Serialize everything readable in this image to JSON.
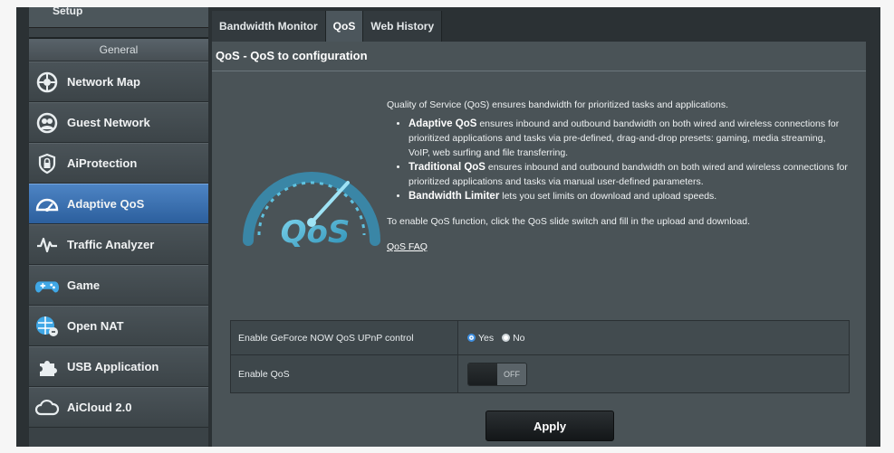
{
  "sidebar": {
    "top_item": "Setup",
    "group_header": "General",
    "items": [
      {
        "label": "Network Map",
        "icon": "network-map-icon"
      },
      {
        "label": "Guest Network",
        "icon": "guest-network-icon"
      },
      {
        "label": "AiProtection",
        "icon": "shield-lock-icon"
      },
      {
        "label": "Adaptive QoS",
        "icon": "speedometer-icon",
        "active": true
      },
      {
        "label": "Traffic Analyzer",
        "icon": "waveform-icon"
      },
      {
        "label": "Game",
        "icon": "gamepad-icon"
      },
      {
        "label": "Open NAT",
        "icon": "open-nat-icon"
      },
      {
        "label": "USB Application",
        "icon": "usb-puzzle-icon"
      },
      {
        "label": "AiCloud 2.0",
        "icon": "cloud-icon"
      }
    ]
  },
  "tabs": [
    {
      "label": "Bandwidth Monitor",
      "active": false
    },
    {
      "label": "QoS",
      "active": true
    },
    {
      "label": "Web History",
      "active": false
    }
  ],
  "main": {
    "title": "QoS - QoS to configuration",
    "intro": "Quality of Service (QoS) ensures bandwidth for prioritized tasks and applications.",
    "bullets": [
      {
        "bold": "Adaptive QoS",
        "text": " ensures inbound and outbound bandwidth on both wired and wireless connections for prioritized applications and tasks via pre-defined, drag-and-drop presets: gaming, media streaming, VoIP, web surfing and file transferring."
      },
      {
        "bold": "Traditional QoS",
        "text": " ensures inbound and outbound bandwidth on both wired and wireless connections for prioritized applications and tasks via manual user-defined parameters."
      },
      {
        "bold": "Bandwidth Limiter",
        "text": " lets you set limits on download and upload speeds."
      }
    ],
    "enable_text": "To enable QoS function, click the QoS slide switch and fill in the upload and download.",
    "faq_link": "QoS FAQ",
    "gauge_text": "QoS"
  },
  "settings": {
    "geforce_label": "Enable GeForce NOW QoS UPnP control",
    "geforce_yes": "Yes",
    "geforce_no": "No",
    "geforce_value": "Yes",
    "enable_qos_label": "Enable QoS",
    "enable_qos_state": "OFF"
  },
  "apply_label": "Apply",
  "colors": {
    "accent_blue": "#3f8fe0",
    "active_item": "#3b72b4",
    "gauge_cyan": "#4fb8d8"
  }
}
